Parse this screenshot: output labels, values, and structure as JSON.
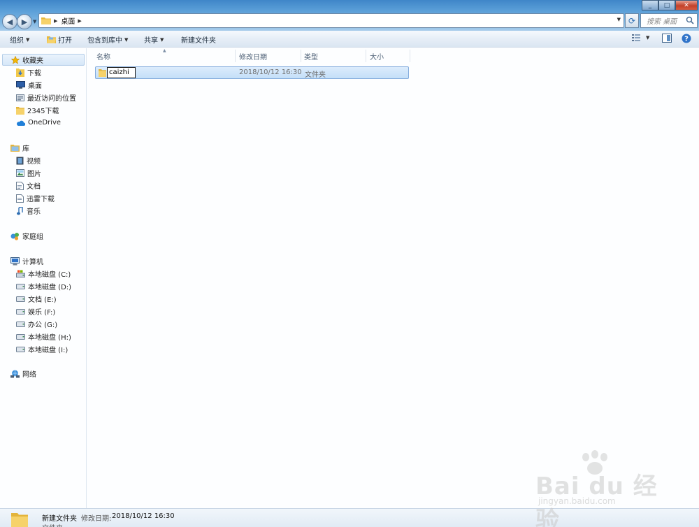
{
  "window": {
    "address_path": "桌面",
    "search_placeholder": "搜索 桌面",
    "controls": {
      "minimize": "_",
      "maximize": "□",
      "close": "✕"
    }
  },
  "toolbar": {
    "organize": "组织",
    "open": "打开",
    "include_library": "包含到库中",
    "share": "共享",
    "new_folder": "新建文件夹"
  },
  "nav": {
    "favorites": {
      "label": "收藏夹",
      "items": [
        "下载",
        "桌面",
        "最近访问的位置",
        "2345下载",
        "OneDrive"
      ]
    },
    "libraries": {
      "label": "库",
      "items": [
        "视频",
        "图片",
        "文档",
        "迅雷下载",
        "音乐"
      ]
    },
    "homegroup": "家庭组",
    "computer": {
      "label": "计算机",
      "drives": [
        "本地磁盘 (C:)",
        "本地磁盘 (D:)",
        "文档 (E:)",
        "娱乐 (F:)",
        "办公 (G:)",
        "本地磁盘 (H:)",
        "本地磁盘 (I:)"
      ]
    },
    "network": "网络"
  },
  "columns": {
    "name": "名称",
    "modified": "修改日期",
    "type": "类型",
    "size": "大小"
  },
  "files": [
    {
      "name": "caizhi",
      "modified": "2018/10/12 16:30",
      "type": "文件夹",
      "size": ""
    }
  ],
  "details": {
    "name": "新建文件夹",
    "modified_label": "修改日期:",
    "modified_value": "2018/10/12 16:30",
    "type": "文件夹"
  },
  "watermark": {
    "logo": "Bai du 经验",
    "url": "jingyan.baidu.com"
  },
  "colors": {
    "title_gradient_top": "#3f86c8",
    "selection_border": "#84acdd",
    "folder_yellow": "#f2c94c",
    "close_red": "#c2412a"
  }
}
